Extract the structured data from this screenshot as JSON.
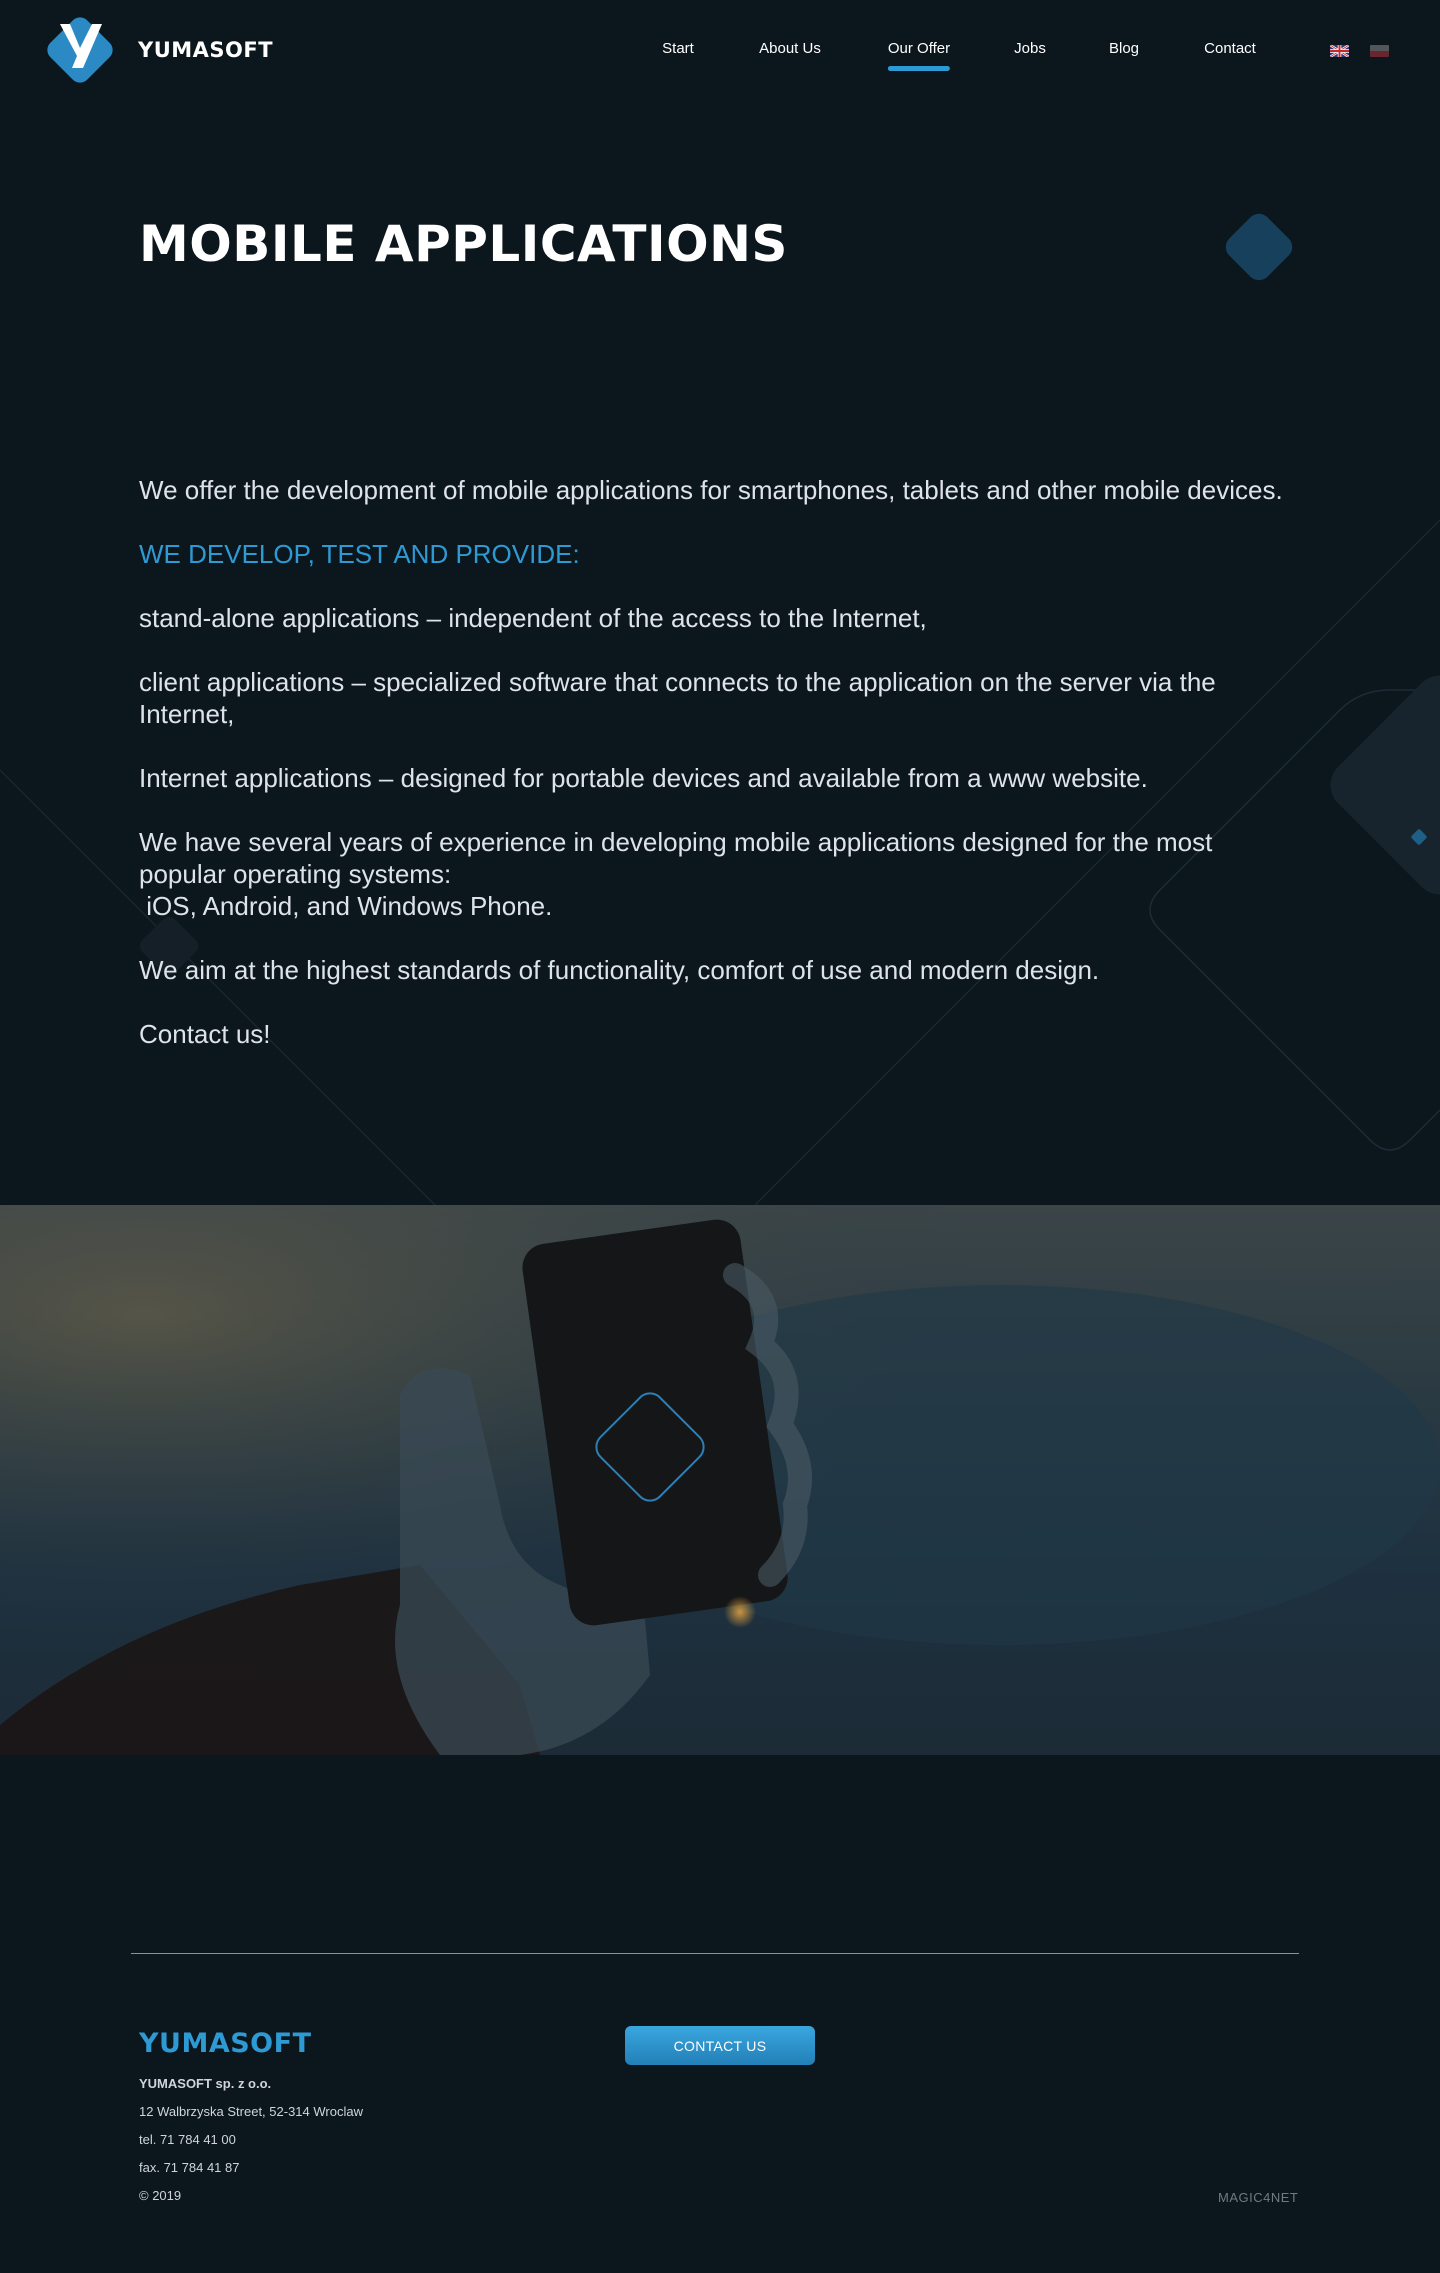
{
  "header": {
    "brand": "YUMASOFT",
    "nav": [
      "Start",
      "About Us",
      "Our Offer",
      "Jobs",
      "Blog",
      "Contact"
    ],
    "active_nav": "Our Offer",
    "languages": [
      "English",
      "Polski"
    ]
  },
  "hero": {
    "title": "MOBILE APPLICATIONS"
  },
  "content": {
    "intro": "We offer the development of mobile applications for smartphones, tablets and other mobile devices.",
    "subhead": "WE DEVELOP, TEST AND PROVIDE:",
    "item1": "stand-alone applications – independent of the access to the Internet,",
    "item2": "client applications – specialized software that connects to the application on the server via the Internet,",
    "item3": "Internet applications – designed for portable devices and available from a www website.",
    "experience": "We have several years of experience in developing mobile applications designed for the most popular operating systems:",
    "systems": " iOS, Android, and Windows Phone.",
    "standards": "We aim at the highest standards of functionality, comfort of use and modern design.",
    "cta": "Contact us!"
  },
  "footer": {
    "brand": "YUMASOFT",
    "company": "YUMASOFT sp. z o.o.",
    "street": "12 Walbrzyska Street, 52-314 Wroclaw",
    "tel": "tel. 71 784 41 00",
    "fax": "fax. 71 784 41 87",
    "year": "© 2019",
    "contact_button": "CONTACT US",
    "credit": "MAGIC4NET"
  },
  "colors": {
    "background": "#0c161d",
    "accent": "#2e9ad3",
    "text": "#e3e8ec"
  }
}
